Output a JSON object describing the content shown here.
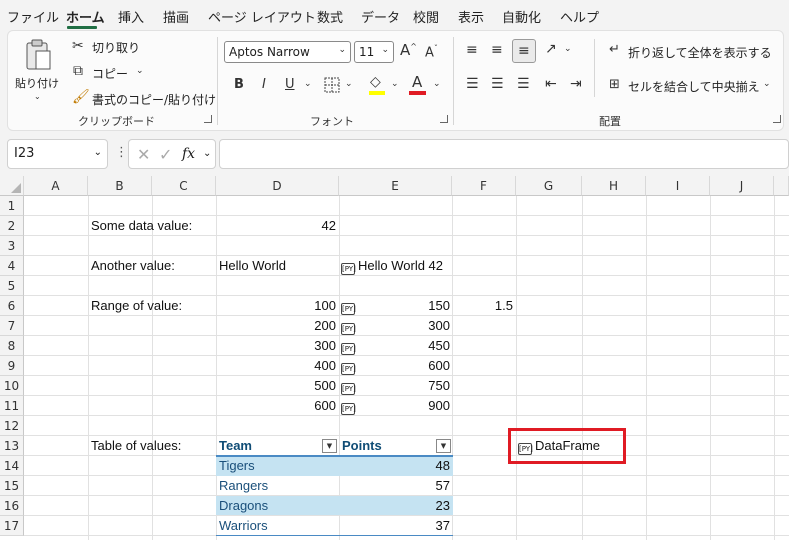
{
  "menu": {
    "items": [
      "ファイル",
      "ホーム",
      "挿入",
      "描画",
      "ページ レイアウト",
      "数式",
      "データ",
      "校閲",
      "表示",
      "自動化",
      "ヘルプ"
    ],
    "active": "ホーム"
  },
  "ribbon": {
    "clipboard": {
      "paste_label": "貼り付け",
      "cut_label": "切り取り",
      "copy_label": "コピー",
      "format_painter_label": "書式のコピー/貼り付け",
      "group_label": "クリップボード"
    },
    "font": {
      "font_name": "Aptos Narrow",
      "font_size": "11",
      "bold": "B",
      "italic": "I",
      "underline": "U",
      "group_label": "フォント",
      "highlight_color": "#ffff00",
      "font_color": "#e01b24"
    },
    "alignment": {
      "wrap_label": "折り返して全体を表示する",
      "merge_label": "セルを結合して中央揃え",
      "group_label": "配置"
    }
  },
  "formula_bar": {
    "name_box": "I23",
    "fx": "fx",
    "content": ""
  },
  "grid": {
    "columns": [
      "A",
      "B",
      "C",
      "D",
      "E",
      "F",
      "G",
      "H",
      "I",
      "J"
    ],
    "rows": [
      "1",
      "2",
      "3",
      "4",
      "5",
      "6",
      "7",
      "8",
      "9",
      "10",
      "11",
      "12",
      "13",
      "14",
      "15",
      "16",
      "17"
    ],
    "py_icon": "[PY]",
    "cells": {
      "B2": "Some data value:",
      "D2": "42",
      "B4": "Another value:",
      "D4": "Hello World",
      "E4": "Hello World 42",
      "B6": "Range of value:",
      "F6": "1.5",
      "D_range": [
        "100",
        "200",
        "300",
        "400",
        "500",
        "600"
      ],
      "E_range": [
        "150",
        "300",
        "450",
        "600",
        "750",
        "900"
      ],
      "B13": "Table of values:",
      "G13": "DataFrame"
    },
    "table": {
      "headers": [
        "Team",
        "Points"
      ],
      "rows": [
        [
          "Tigers",
          "48"
        ],
        [
          "Rangers",
          "57"
        ],
        [
          "Dragons",
          "23"
        ],
        [
          "Warriors",
          "37"
        ]
      ],
      "header_color": "#0f4c75",
      "band_color": "#c5e3f2",
      "text_color": "#1a4f7a"
    },
    "highlight_box_color": "#e01b24"
  }
}
